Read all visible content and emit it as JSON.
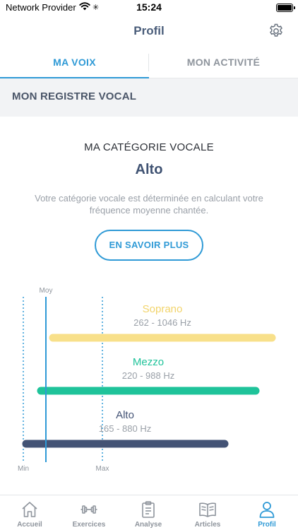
{
  "status_bar": {
    "carrier": "Network Provider",
    "time": "15:24"
  },
  "nav": {
    "title": "Profil",
    "settings_icon": "gear-icon"
  },
  "tabs": [
    {
      "label": "MA VOIX",
      "active": true
    },
    {
      "label": "MON ACTIVITÉ",
      "active": false
    }
  ],
  "section": {
    "title": "MON REGISTRE VOCAL"
  },
  "category": {
    "label": "MA CATÉGORIE VOCALE",
    "value": "Alto",
    "description": "Votre catégorie vocale est déterminée en calculant votre fréquence moyenne chantée.",
    "button_label": "EN SAVOIR PLUS"
  },
  "chart_data": {
    "type": "range",
    "markers": {
      "min_label": "Min",
      "max_label": "Max",
      "avg_label": "Moy"
    },
    "series": [
      {
        "name": "Soprano",
        "range_label": "262 - 1046 Hz",
        "color": "#f8e08a"
      },
      {
        "name": "Mezzo",
        "range_label": "220 - 988 Hz",
        "color": "#1fc39a"
      },
      {
        "name": "Alto",
        "range_label": "165 - 880 Hz",
        "color": "#435375"
      }
    ]
  },
  "tab_bar": [
    {
      "label": "Accueil",
      "icon": "home-icon",
      "active": false
    },
    {
      "label": "Exercices",
      "icon": "dumbbell-icon",
      "active": false
    },
    {
      "label": "Analyse",
      "icon": "clipboard-icon",
      "active": false
    },
    {
      "label": "Articles",
      "icon": "book-icon",
      "active": false
    },
    {
      "label": "Profil",
      "icon": "user-icon",
      "active": true
    }
  ],
  "colors": {
    "accent": "#2f9ad6",
    "title": "#3f5272",
    "muted": "#8e949c"
  }
}
